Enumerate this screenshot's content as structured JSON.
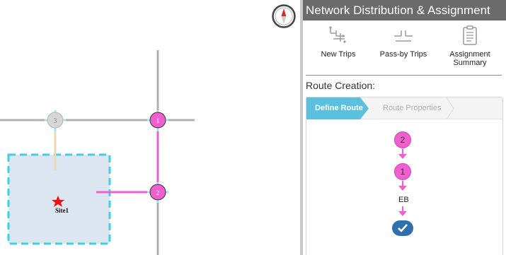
{
  "panel": {
    "title": "Network Distribution & Assignment",
    "tools": [
      {
        "label": "New Trips",
        "icon": "new-trips-icon"
      },
      {
        "label": "Pass-by Trips",
        "icon": "pass-by-trips-icon"
      },
      {
        "label": "Assignment\nSummary",
        "icon": "assignment-summary-icon"
      }
    ],
    "route_creation_label": "Route Creation:",
    "steps": [
      {
        "label": "Define Route",
        "active": true
      },
      {
        "label": "Route Properties",
        "active": false
      }
    ],
    "route_chain": {
      "nodes": [
        "2",
        "1"
      ],
      "direction": "EB"
    }
  },
  "map": {
    "site_label": "Site1",
    "intersections": [
      "3",
      "1",
      "2"
    ],
    "colors": {
      "route": "#f05fd0",
      "site_border": "#3ecfe0",
      "site_fill": "#dce6f0",
      "road": "#b0b0b0"
    }
  }
}
